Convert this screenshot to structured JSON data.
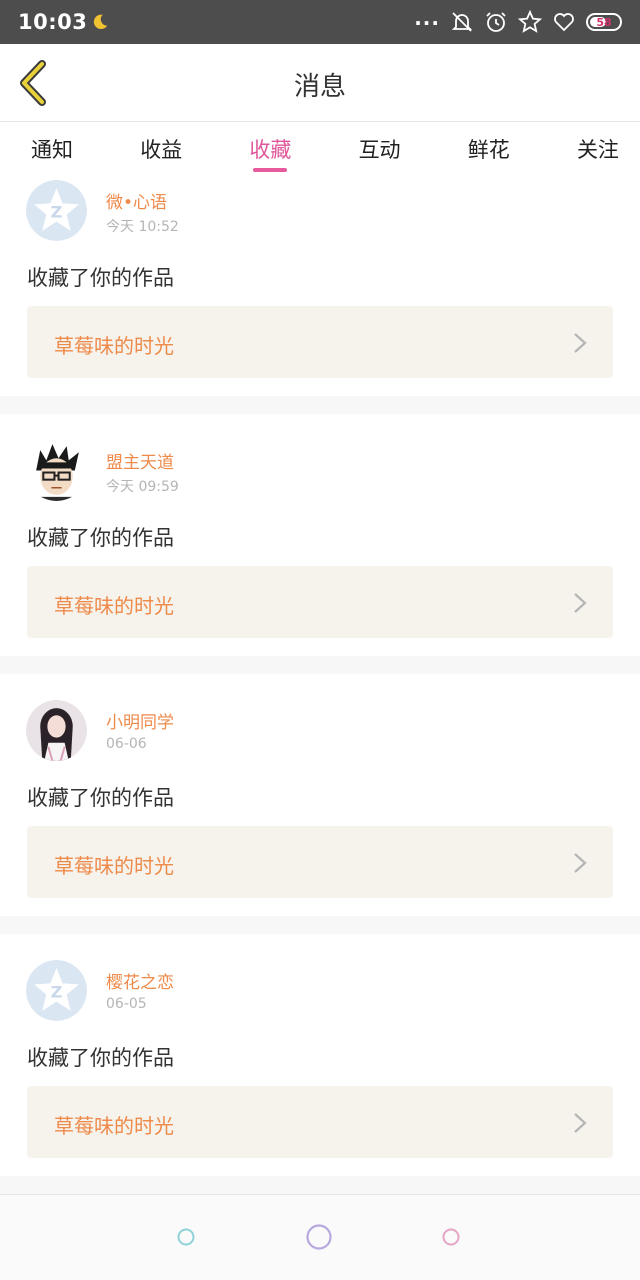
{
  "status": {
    "time": "10:03",
    "battery": "58"
  },
  "header": {
    "title": "消息"
  },
  "tabs": [
    {
      "label": "通知",
      "active": false
    },
    {
      "label": "收益",
      "active": false
    },
    {
      "label": "收藏",
      "active": true
    },
    {
      "label": "互动",
      "active": false
    },
    {
      "label": "鲜花",
      "active": false
    },
    {
      "label": "关注",
      "active": false
    }
  ],
  "messages": [
    {
      "user": "微•心语",
      "time": "今天 10:52",
      "action": "收藏了你的作品",
      "work": "草莓味的时光",
      "avatar": "default-star-avatar"
    },
    {
      "user": "盟主天道",
      "time": "今天 09:59",
      "action": "收藏了你的作品",
      "work": "草莓味的时光",
      "avatar": "anime-avatar"
    },
    {
      "user": "小明同学",
      "time": "06-06",
      "action": "收藏了你的作品",
      "work": "草莓味的时光",
      "avatar": "photo-avatar"
    },
    {
      "user": "樱花之恋",
      "time": "06-05",
      "action": "收藏了你的作品",
      "work": "草莓味的时光",
      "avatar": "default-star-avatar"
    }
  ],
  "colors": {
    "accent": "#e0579a",
    "name": "#ee8a4a",
    "status_bar": "#4d4d4d"
  }
}
